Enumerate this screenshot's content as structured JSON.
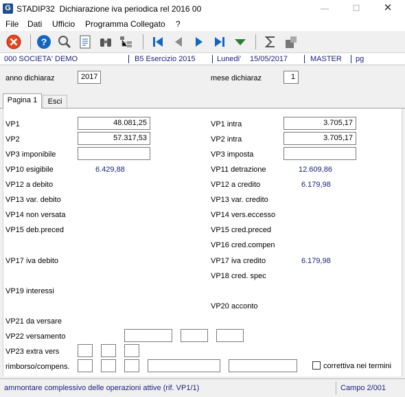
{
  "window": {
    "app_label": "STADIP32",
    "title": "Dichiarazione iva periodica rel 2016 00",
    "icon_letter": "G"
  },
  "menu": [
    "File",
    "Dati",
    "Ufficio",
    "Programma Collegato",
    "?"
  ],
  "toolbar": {
    "icons": [
      "close-icon",
      "help-icon",
      "search-icon",
      "list-icon",
      "binoculars-icon",
      "tree-icon",
      "first-icon",
      "prev-icon",
      "next-icon",
      "last-icon",
      "dropdown-icon",
      "sum-icon",
      "edit-icon"
    ]
  },
  "info": {
    "company": "000 SOCIETA' DEMO",
    "exercise": "B5 Esercizio 2015",
    "day": "Lunedi'",
    "date": "15/05/2017",
    "user": "MASTER",
    "code": "pg"
  },
  "header": {
    "year_label": "anno dichiaraz",
    "year_value": "2017",
    "month_label": "mese dichiaraz",
    "month_value": "1"
  },
  "tabs": {
    "page1": "Pagina 1",
    "exit": "Esci"
  },
  "left": {
    "vp1": {
      "label": "VP1",
      "value": "48.081,25"
    },
    "vp2": {
      "label": "VP2",
      "value": "57.317,53"
    },
    "vp3": {
      "label": "VP3 imponibile",
      "value": ""
    },
    "vp10": {
      "label": "VP10 esigibile",
      "value": "6.429,88"
    },
    "vp12": {
      "label": "VP12 a debito"
    },
    "vp13": {
      "label": "VP13 var. debito"
    },
    "vp14": {
      "label": "VP14 non versata"
    },
    "vp15": {
      "label": "VP15 deb.preced"
    },
    "vp17": {
      "label": "VP17 iva debito"
    },
    "vp19": {
      "label": "VP19 interessi"
    },
    "vp21": {
      "label": "VP21 da versare"
    },
    "vp22": {
      "label": "VP22 versamento"
    },
    "vp23": {
      "label": "VP23 extra vers"
    },
    "rimb": {
      "label": "rimborso/compens."
    }
  },
  "right": {
    "vp1": {
      "label": "VP1 intra",
      "value": "3.705,17"
    },
    "vp2": {
      "label": "VP2 intra",
      "value": "3.705,17"
    },
    "vp3": {
      "label": "VP3 imposta",
      "value": ""
    },
    "vp11": {
      "label": "VP11 detrazione",
      "value": "12.609,86"
    },
    "vp12": {
      "label": "VP12 a credito",
      "value": "6.179,98"
    },
    "vp13": {
      "label": "VP13 var. credito"
    },
    "vp14": {
      "label": "VP14 vers.eccesso"
    },
    "vp15": {
      "label": "VP15 cred.preced"
    },
    "vp16": {
      "label": "VP16 cred.compen"
    },
    "vp17": {
      "label": "VP17 iva credito",
      "value": "6.179,98"
    },
    "vp18": {
      "label": "VP18 cred. spec"
    },
    "vp20": {
      "label": "VP20 acconto"
    }
  },
  "corrective": {
    "label": "correttiva nei termini",
    "checked": false
  },
  "status": {
    "message": "ammontare complessivo delle operazioni attive (rif. VP1/1)",
    "field": "Campo  2/001"
  }
}
